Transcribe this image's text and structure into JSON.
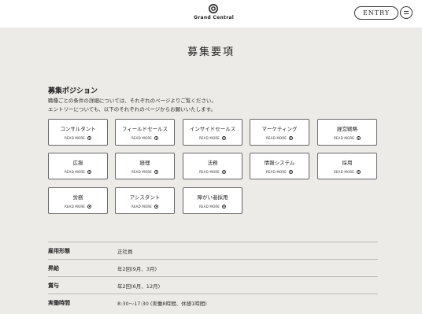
{
  "header": {
    "logo_text": "Grand Central",
    "entry_label": "ENTRY"
  },
  "page_title": "募集要項",
  "positions_section": {
    "title": "募集ポジション",
    "description_line1": "職種ごとの条件の詳細については、それぞれのページよりご覧ください。",
    "description_line2": "エントリーについても、以下のそれぞれのページからお願いいたします。",
    "read_more_label": "READ MORE",
    "cards": [
      {
        "title": "コンサルタント"
      },
      {
        "title": "フィールドセールス"
      },
      {
        "title": "インサイドセールス"
      },
      {
        "title": "マーケティング"
      },
      {
        "title": "経営戦略"
      },
      {
        "title": "広報"
      },
      {
        "title": "経理"
      },
      {
        "title": "法務"
      },
      {
        "title": "情報システム"
      },
      {
        "title": "採用"
      },
      {
        "title": "労務"
      },
      {
        "title": "アシスタント"
      },
      {
        "title": "障がい者採用"
      }
    ]
  },
  "info_table": [
    {
      "label": "雇用形態",
      "value": "正社員"
    },
    {
      "label": "昇給",
      "value": "年2回(9月、3月)"
    },
    {
      "label": "賞与",
      "value": "年2回(6月、12月)"
    },
    {
      "label": "実働時間",
      "value": "8:30〜17:30 (実働8時間、休憩1時間)"
    }
  ]
}
